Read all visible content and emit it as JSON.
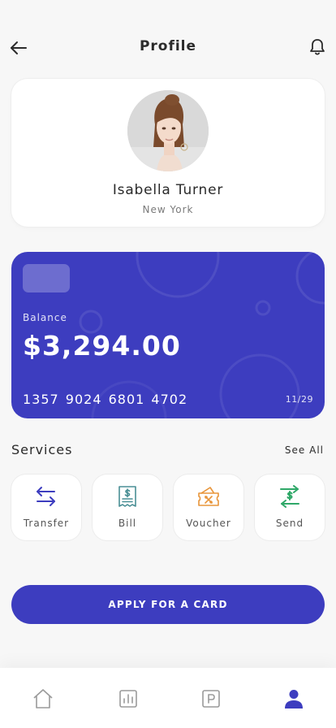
{
  "header": {
    "title": "Profile",
    "back_icon": "arrow-left-icon",
    "notification_icon": "bell-icon"
  },
  "profile": {
    "name": "Isabella Turner",
    "location": "New York"
  },
  "card": {
    "balance_label": "Balance",
    "balance": "$3,294.00",
    "number": "1357 9024 6801 4702",
    "expiry": "11/29",
    "color": "#3d3dbf"
  },
  "services": {
    "title": "Services",
    "see_all": "See All",
    "items": [
      {
        "label": "Transfer",
        "icon": "transfer-arrows-icon",
        "color": "#3d3dbf"
      },
      {
        "label": "Bill",
        "icon": "bill-receipt-icon",
        "color": "#4a8f95"
      },
      {
        "label": "Voucher",
        "icon": "voucher-ticket-icon",
        "color": "#e8953a"
      },
      {
        "label": "Send",
        "icon": "send-money-icon",
        "color": "#2fa868"
      }
    ]
  },
  "apply_button": {
    "label": "APPLY FOR A CARD"
  },
  "bottom_nav": {
    "items": [
      {
        "name": "home",
        "icon": "home-icon",
        "active": false
      },
      {
        "name": "stats",
        "icon": "bar-chart-icon",
        "active": false
      },
      {
        "name": "wallet",
        "icon": "wallet-icon",
        "active": false
      },
      {
        "name": "profile",
        "icon": "user-icon",
        "active": true
      }
    ],
    "active_color": "#3d3dbf",
    "inactive_color": "#9a9a9a"
  }
}
